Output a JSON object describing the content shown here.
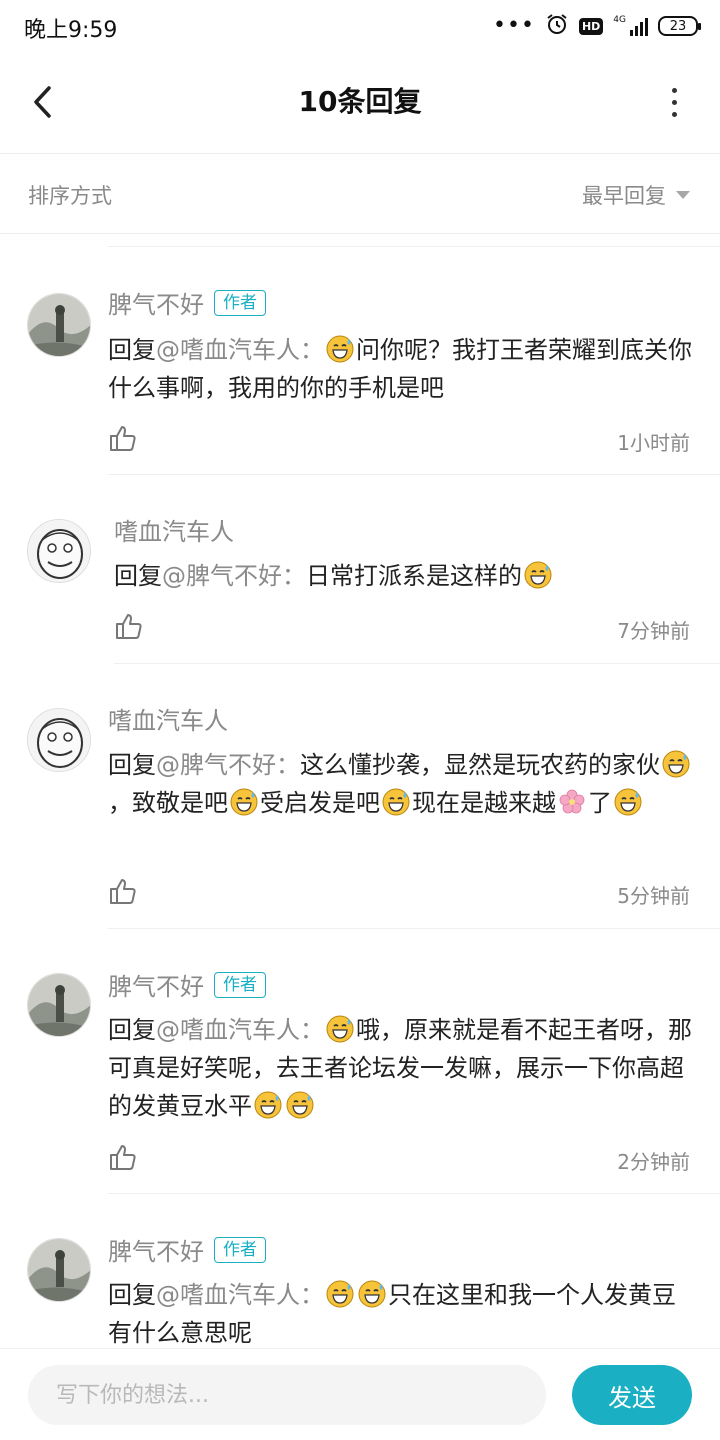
{
  "status_bar": {
    "time": "晚上9:59",
    "network": "4G",
    "hd": "HD",
    "battery": "23"
  },
  "header": {
    "title": "10条回复"
  },
  "sort": {
    "label": "排序方式",
    "value": "最早回复"
  },
  "comments": [
    {
      "name": "脾气不好",
      "tag": "作者",
      "reply_prefix": "回复",
      "mention": "@嗜血汽车人：",
      "text": "问你呢？我打王者荣耀到底关你什么事啊，我用的你的手机是吧",
      "time": "1小时前"
    },
    {
      "name": "嗜血汽车人",
      "reply_prefix": "回复",
      "mention": "@脾气不好：",
      "text": "日常打派系是这样的",
      "time": "7分钟前"
    },
    {
      "name": "嗜血汽车人",
      "reply_prefix": "回复",
      "mention": "@脾气不好：",
      "text_parts": [
        "这么懂抄袭，显然是玩农药的家伙",
        "，致敬是吧",
        "受启发是吧",
        "现在是越来越",
        "了"
      ],
      "time": "5分钟前"
    },
    {
      "name": "脾气不好",
      "tag": "作者",
      "reply_prefix": "回复",
      "mention": "@嗜血汽车人：",
      "text": "哦，原来就是看不起王者呀，那可真是好笑呢，去王者论坛发一发嘛，展示一下你高超的发黄豆水平",
      "time": "2分钟前"
    },
    {
      "name": "脾气不好",
      "tag": "作者",
      "reply_prefix": "回复",
      "mention": "@嗜血汽车人：",
      "text": "只在这里和我一个人发黄豆有什么意思呢"
    }
  ],
  "input": {
    "placeholder": "写下你的想法..."
  },
  "send_label": "发送",
  "colors": {
    "accent": "#1aafc2",
    "muted_text": "#8a8a8a",
    "divider": "#efefef"
  }
}
